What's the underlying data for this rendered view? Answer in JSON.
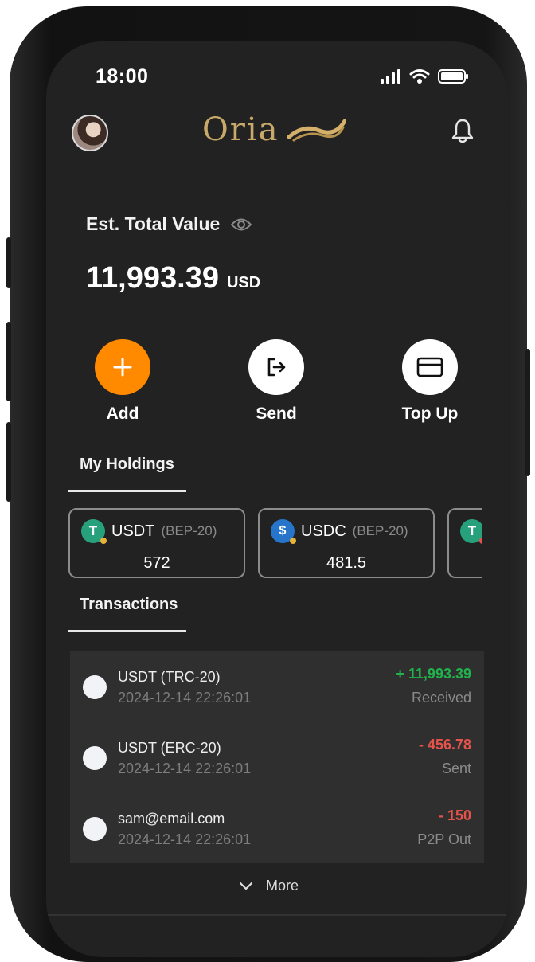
{
  "status_bar": {
    "time": "18:00",
    "signal_icon": "signal-icon",
    "wifi_icon": "wifi-icon",
    "battery_icon": "battery-icon"
  },
  "header": {
    "logo_text": "Oria",
    "avatar": "user-avatar",
    "bell_icon": "bell-icon"
  },
  "balance": {
    "label": "Est. Total Value",
    "value": "11,993.39",
    "unit": "USD",
    "eye_icon": "eye-icon"
  },
  "actions": [
    {
      "label": "Add",
      "icon": "plus-icon",
      "color": "#FF8A00"
    },
    {
      "label": "Send",
      "icon": "send-icon",
      "color": "#FFFFFF"
    },
    {
      "label": "Top Up",
      "icon": "card-icon",
      "color": "#FFFFFF"
    }
  ],
  "holdings": {
    "tab_label": "My Holdings",
    "items": [
      {
        "name": "USDT",
        "network": "(BEP-20)",
        "amount": "572",
        "icon": "tether-icon",
        "icon_color": "#26A17B"
      },
      {
        "name": "USDC",
        "network": "(BEP-20)",
        "amount": "481.5",
        "icon": "usdc-icon",
        "icon_color": "#2775CA"
      },
      {
        "name": "",
        "network": "",
        "amount": "",
        "icon": "tether-icon",
        "icon_color": "#26A17B"
      }
    ]
  },
  "transactions": {
    "tab_label": "Transactions",
    "items": [
      {
        "name": "USDT (TRC-20)",
        "date": "2024-12-14 22:26:01",
        "amount": "+ 11,993.39",
        "status": "Received",
        "amount_color": "#22B24C"
      },
      {
        "name": "USDT (ERC-20)",
        "date": "2024-12-14 22:26:01",
        "amount": "- 456.78",
        "status": "Sent",
        "amount_color": "#E5534B"
      },
      {
        "name": "sam@email.com",
        "date": "2024-12-14 22:26:01",
        "amount": "- 150",
        "status": "P2P Out",
        "amount_color": "#E5534B"
      }
    ],
    "more_label": "More",
    "more_icon": "chevron-down-icon"
  }
}
